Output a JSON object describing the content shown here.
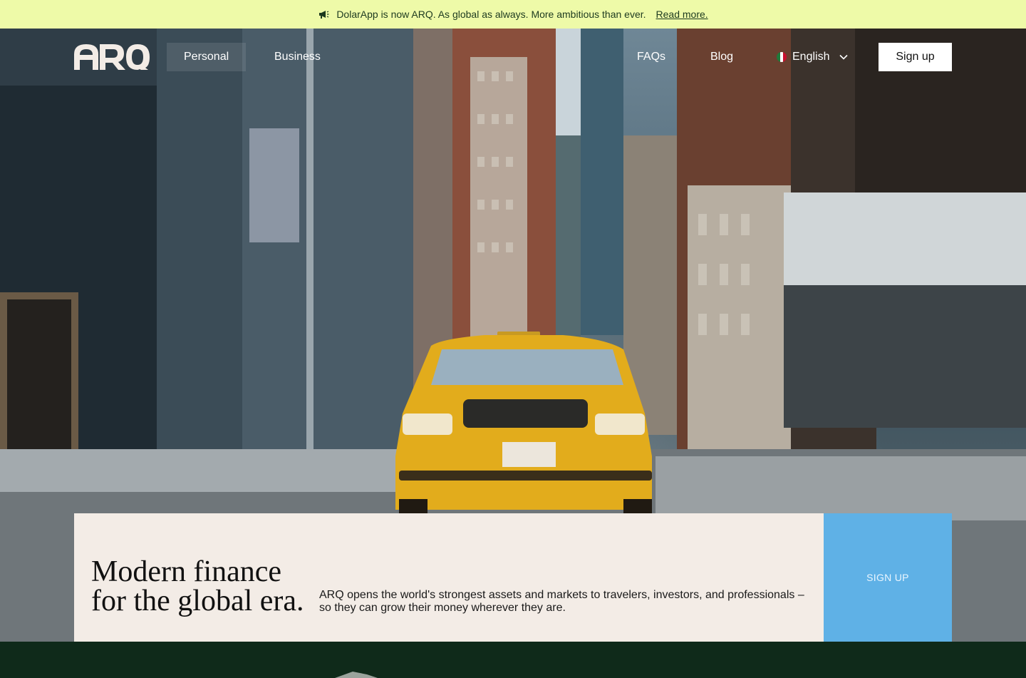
{
  "announcement": {
    "icon": "megaphone-icon",
    "text": "DolarApp is now ARQ. As global as always. More ambitious than ever.",
    "link": "Read more."
  },
  "nav": {
    "logo_text": "ARQ",
    "links_left": [
      "Personal",
      "Business"
    ],
    "links_right": [
      "FAQs",
      "Blog"
    ],
    "language": "English",
    "signup": "Sign up"
  },
  "hero": {
    "headline_line1": "Modern finance",
    "headline_line2": "for the global era.",
    "description": "ARQ opens the world's strongest assets and markets to travelers, investors, and professionals – so they can grow their money wherever they are.",
    "cta": "SIGN UP"
  },
  "colors": {
    "announcement_bg": "#eefaa8",
    "card_bg": "#f3ece6",
    "cta_bg": "#5fb1e6",
    "footer_bg": "#0f2a1a",
    "taxi": "#e8b020"
  }
}
